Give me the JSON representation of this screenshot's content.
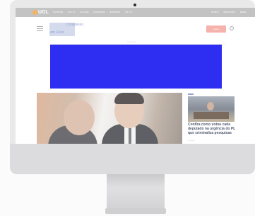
{
  "topbar": {
    "logo": "UOL",
    "nav_items": [
      "NOTÍCIAS",
      "UOL TV",
      "PLACAR",
      "ECONOMIA",
      "ESPORTE",
      "UOL TV"
    ],
    "right_items": [
      "BUSCA",
      "BATE-PAPO",
      "EMAIL"
    ]
  },
  "header": {
    "brand_line1": "Congresso",
    "brand_line2": "em Foco",
    "subscribe_label": "Assine"
  },
  "ad": {
    "label": "PUBLICIDADE",
    "color": "#0000f0"
  },
  "side_story": {
    "headline": "Confira como votou cada deputado na urgência do PL que criminaliza pesquisas",
    "meta": "há 2 horas"
  },
  "icons": {
    "menu": "hamburger-menu-icon",
    "search": "search-icon"
  },
  "colors": {
    "topbar": "#b6b6b8",
    "accent": "#7a8fc8",
    "subscribe": "#f4a19a"
  }
}
